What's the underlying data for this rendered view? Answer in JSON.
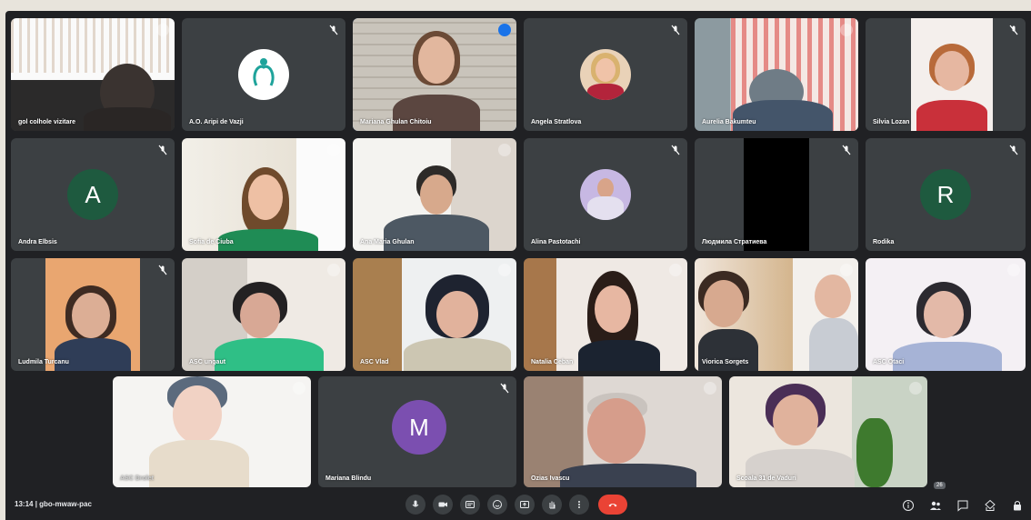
{
  "meeting": {
    "time": "13:14",
    "code": "gbo-mwaw-pac",
    "participants_badge": "26"
  },
  "participants": [
    {
      "name": "gol colhole vizitare",
      "mic_muted": true
    },
    {
      "name": "A.O. Aripi de Vazji",
      "mic_muted": true
    },
    {
      "name": "Mariana Ghulan Chitoiu",
      "mic_muted": false,
      "speaking": true
    },
    {
      "name": "Angela Stratlova",
      "mic_muted": true
    },
    {
      "name": "Aurelia Bakumteu",
      "mic_muted": false
    },
    {
      "name": "Silvia Lozan",
      "mic_muted": true
    },
    {
      "name": "Andra Elbsis",
      "mic_muted": true,
      "initial": "A"
    },
    {
      "name": "Sofia de Ciuba",
      "mic_muted": false
    },
    {
      "name": "Ana Maria Ghulan",
      "mic_muted": false
    },
    {
      "name": "Alina Pastotachi",
      "mic_muted": true
    },
    {
      "name": "Людмила Стратиева",
      "mic_muted": true
    },
    {
      "name": "Rodika",
      "mic_muted": true,
      "initial": "R"
    },
    {
      "name": "Ludmila Turcanu",
      "mic_muted": true
    },
    {
      "name": "ASC ungaut",
      "mic_muted": false
    },
    {
      "name": "ASC Vlad",
      "mic_muted": false
    },
    {
      "name": "Natalia Ceban",
      "mic_muted": false
    },
    {
      "name": "Viorica Sorgets",
      "mic_muted": false
    },
    {
      "name": "ASC Otaci",
      "mic_muted": false
    },
    {
      "name": "ASC Drolet",
      "mic_muted": false
    },
    {
      "name": "Mariana Blindu",
      "mic_muted": true,
      "initial": "M"
    },
    {
      "name": "Ozias Ivascu",
      "mic_muted": false
    },
    {
      "name": "Scoala 31 de Vaduri",
      "mic_muted": false
    }
  ],
  "controls": [
    "mic-icon",
    "camera-icon",
    "captions-icon",
    "emoji-icon",
    "present-icon",
    "raise-hand-icon",
    "more-options-icon",
    "end-call-icon"
  ],
  "right_icons": [
    "info-icon",
    "people-icon",
    "chat-icon",
    "activities-icon",
    "host-controls-icon"
  ],
  "colors": {
    "background": "#202124",
    "tile": "#3c4043",
    "avatar_green": "#1e5a3f",
    "avatar_purple": "#7b4fb0",
    "end_call": "#ea4335",
    "speaking": "#8ab4f8"
  }
}
